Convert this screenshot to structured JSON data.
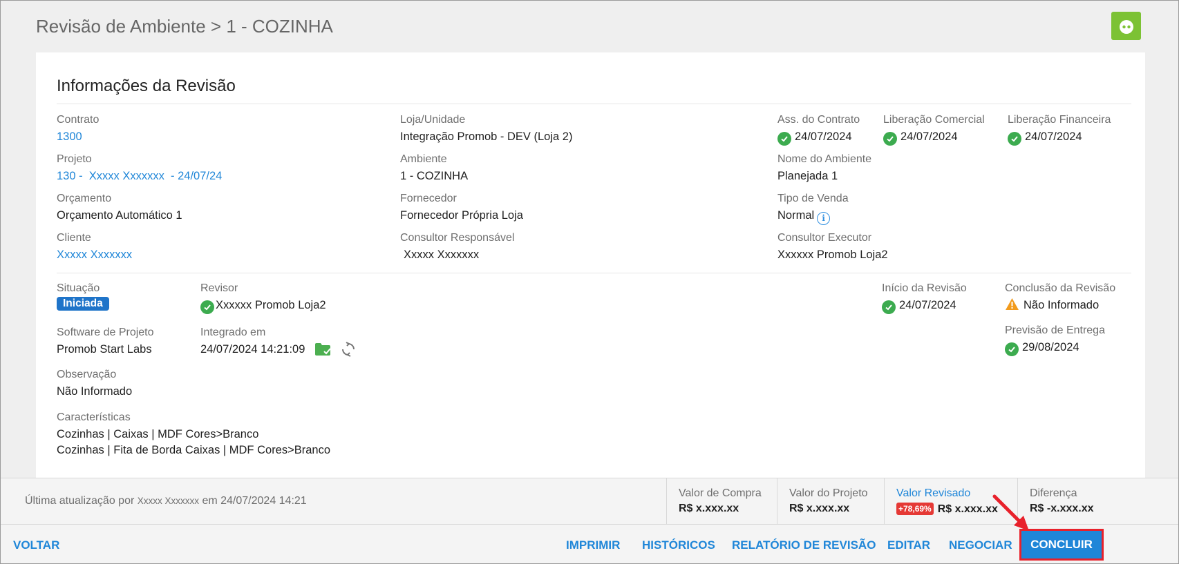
{
  "header": {
    "title": "Revisão de Ambiente > 1 - COZINHA"
  },
  "card": {
    "title": "Informações da Revisão",
    "fields": {
      "contrato": {
        "label": "Contrato",
        "value": "1300"
      },
      "projeto": {
        "label": "Projeto",
        "value": "130 -  Xxxxx Xxxxxxx  - 24/07/24"
      },
      "orcamento": {
        "label": "Orçamento",
        "value": "Orçamento Automático 1"
      },
      "cliente": {
        "label": "Cliente",
        "value": "Xxxxx Xxxxxxx"
      },
      "loja": {
        "label": "Loja/Unidade",
        "value": "Integração Promob - DEV (Loja 2)"
      },
      "ambiente": {
        "label": "Ambiente",
        "value": "1 - COZINHA"
      },
      "fornecedor": {
        "label": "Fornecedor",
        "value": "Fornecedor Própria Loja"
      },
      "consultor_resp": {
        "label": "Consultor Responsável",
        "value": "Xxxxx Xxxxxxx"
      },
      "ass_contrato": {
        "label": "Ass. do Contrato",
        "value": "24/07/2024"
      },
      "lib_comercial": {
        "label": "Liberação Comercial",
        "value": "24/07/2024"
      },
      "lib_financeira": {
        "label": "Liberação Financeira",
        "value": "24/07/2024"
      },
      "nome_ambiente": {
        "label": "Nome do Ambiente",
        "value": "Planejada 1"
      },
      "tipo_venda": {
        "label": "Tipo de Venda",
        "value": "Normal"
      },
      "consultor_exec": {
        "label": "Consultor Executor",
        "value": "Xxxxxx Promob Loja2"
      },
      "situacao": {
        "label": "Situação",
        "value": "Iniciada"
      },
      "revisor": {
        "label": "Revisor",
        "value": "Xxxxxx Promob Loja2"
      },
      "software": {
        "label": "Software de Projeto",
        "value": "Promob Start Labs"
      },
      "integrado": {
        "label": "Integrado em",
        "value": "24/07/2024 14:21:09"
      },
      "observacao": {
        "label": "Observação",
        "value": "Não Informado"
      },
      "caracteristicas": {
        "label": "Características",
        "line1": "Cozinhas | Caixas | MDF Cores>Branco",
        "line2": "Cozinhas | Fita de Borda Caixas | MDF Cores>Branco"
      },
      "inicio": {
        "label": "Início da Revisão",
        "value": "24/07/2024"
      },
      "conclusao": {
        "label": "Conclusão da Revisão",
        "value": "Não Informado"
      },
      "previsao": {
        "label": "Previsão de Entrega",
        "value": "29/08/2024"
      }
    }
  },
  "footer": {
    "last_update_prefix": "Última atualização por ",
    "last_update_user": "Xxxxx Xxxxxxx",
    "last_update_suffix": " em 24/07/2024 14:21",
    "valor_compra": {
      "label": "Valor de Compra",
      "value": "R$ x.xxx.xx"
    },
    "valor_projeto": {
      "label": "Valor do Projeto",
      "value": "R$ x.xxx.xx"
    },
    "valor_revisado": {
      "label": "Valor Revisado",
      "badge": "+78,69%",
      "value": "R$ x.xxx.xx"
    },
    "diferenca": {
      "label": "Diferença",
      "value": "R$ -x.xxx.xx"
    }
  },
  "actions": {
    "voltar": "VOLTAR",
    "imprimir": "IMPRIMIR",
    "historicos": "HISTÓRICOS",
    "relatorio": "RELATÓRIO DE REVISÃO",
    "editar": "EDITAR",
    "negociar": "NEGOCIAR",
    "concluir": "CONCLUIR"
  },
  "colors": {
    "accent": "#1f86d8",
    "success": "#3cab4f",
    "status_badge": "#1f74c9",
    "alert": "#e53935",
    "help_button": "#7cc234"
  },
  "icons": [
    "help-robot-icon",
    "check-circle-icon",
    "info-icon",
    "warning-icon",
    "folder-check-icon",
    "sync-icon",
    "red-arrow-annotation"
  ]
}
